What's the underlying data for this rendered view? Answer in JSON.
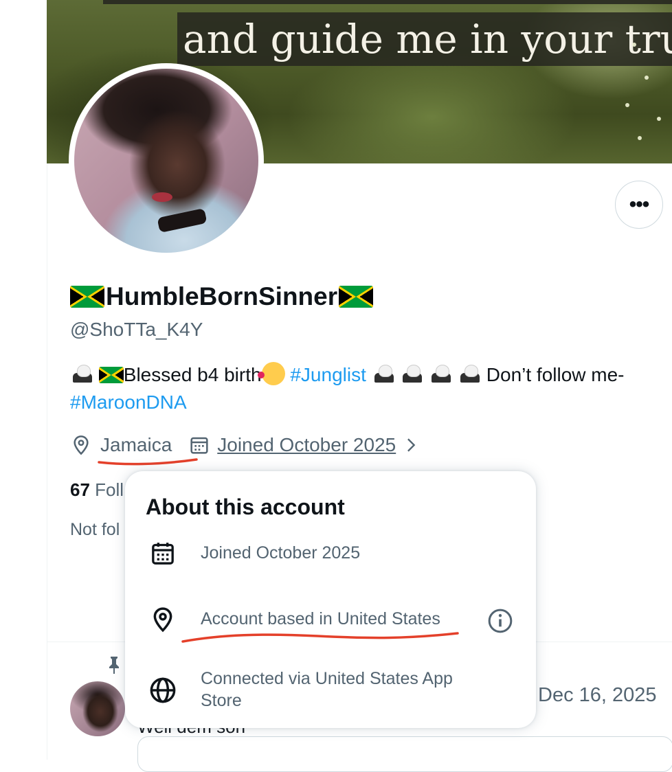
{
  "banner": {
    "caption_line1": "",
    "caption_line2": "and guide me in your tru"
  },
  "profile": {
    "display_name": "HumbleBornSinner",
    "handle": "@ShoTTa_K4Y",
    "bio_text1": "Blessed b4 birth",
    "bio_hashtag1": "#Junglist",
    "bio_text2": " Don’t follow me-",
    "bio_hashtag2": "#MaroonDNA",
    "location": "Jamaica",
    "joined": "Joined October 2025",
    "following_count": "67",
    "following_label": " Foll",
    "not_followed": "Not fol"
  },
  "about_popup": {
    "title": "About this account",
    "joined": "Joined October 2025",
    "based_in": "Account based in United States",
    "connected_line1": "Connected via United States App",
    "connected_line2": "Store"
  },
  "pinned_tweet": {
    "date": "Dec 16, 2025",
    "text": "Well dem soh"
  },
  "colors": {
    "accent": "#1d9bf0",
    "secondary_text": "#536471",
    "annotation_red": "#e4402a"
  },
  "icons": [
    "more-icon",
    "location-icon",
    "calendar-icon",
    "chevron-right-icon",
    "pin-icon",
    "globe-icon",
    "info-icon",
    "eagle-icon",
    "jamaica-flag-icon",
    "blush-face-icon"
  ]
}
